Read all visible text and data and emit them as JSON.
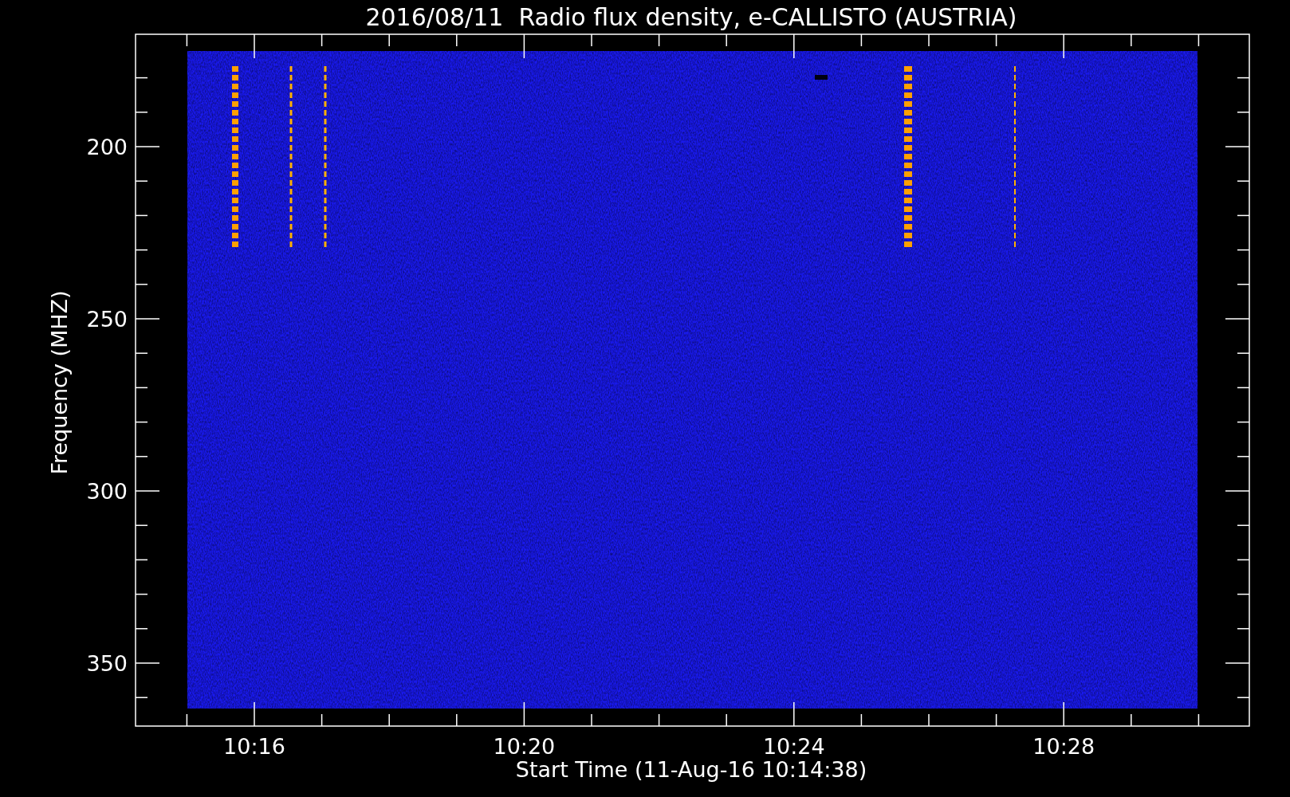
{
  "plot": {
    "title": "2016/08/11  Radio flux density, e-CALLISTO (AUSTRIA)",
    "ylabel": "Frequency (MHZ)",
    "xlabel": "Start Time (11-Aug-16 10:14:38)",
    "yticks": [
      "200",
      "250",
      "300",
      "350"
    ],
    "xticks": [
      "10:16",
      "10:20",
      "10:24",
      "10:28"
    ]
  }
}
